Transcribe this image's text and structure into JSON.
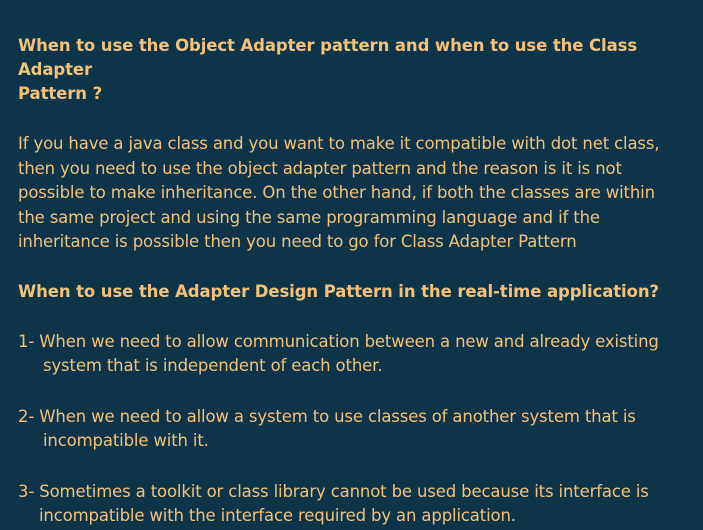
{
  "section1": {
    "heading_line1": "When to use the Object Adapter pattern and when to use the Class Adapter",
    "heading_line2": "Pattern ?",
    "paragraph_lines": [
      "If you have a java class and you want to make it compatible with dot net class,",
      "then you need to use the object adapter pattern and the reason is it is not",
      "possible to make inheritance. On the other hand, if both the classes are within",
      "the same project and using the same programming language and if the",
      "inheritance is possible then you need to go for Class Adapter Pattern"
    ]
  },
  "section2": {
    "heading": "When to use the Adapter Design Pattern in the real-time application?",
    "items": [
      {
        "line1": "1- When we need to allow communication between a new and already existing",
        "line2": "system that is independent of each other."
      },
      {
        "line1": "2- When we need to allow a system to use classes of another system that is",
        "line2": "incompatible with it."
      },
      {
        "line1": "3- Sometimes a toolkit or class library cannot be used because its interface is",
        "line2": "incompatible with the interface required by an application."
      }
    ]
  }
}
